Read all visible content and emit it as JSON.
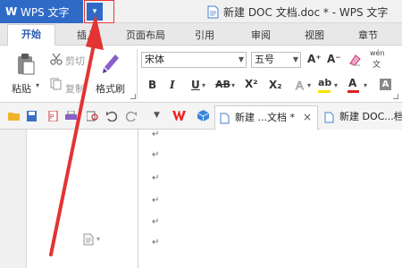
{
  "title_bar": {
    "app_name": "WPS 文字",
    "app_logo": "W",
    "menu_arrow": "▾",
    "document_title": "新建 DOC 文档.doc * - WPS 文字"
  },
  "ribbon_tabs": [
    "开始",
    "插入",
    "页面布局",
    "引用",
    "审阅",
    "视图",
    "章节"
  ],
  "ribbon": {
    "paste_label": "粘贴",
    "cut_label": "剪切",
    "copy_label": "复制",
    "format_painter_label": "格式刷",
    "font_name": "宋体",
    "font_size": "五号",
    "bold": "B",
    "italic": "I",
    "underline": "U",
    "strikethrough": "AB",
    "superscript": "X²",
    "subscript": "X₂",
    "grow_font": "A⁺",
    "shrink_font": "A⁻",
    "font_color_label": "A",
    "highlight_label": "ab",
    "phonetic_label": "wén"
  },
  "doc_tabs": [
    {
      "label": "新建 ...文档 *",
      "close": "×",
      "active": true
    },
    {
      "label": "新建 DOC...档",
      "active": false
    }
  ],
  "paragraph_mark": "↵",
  "colors": {
    "accent": "#2f6ac6",
    "annotation_red": "#e33333"
  }
}
